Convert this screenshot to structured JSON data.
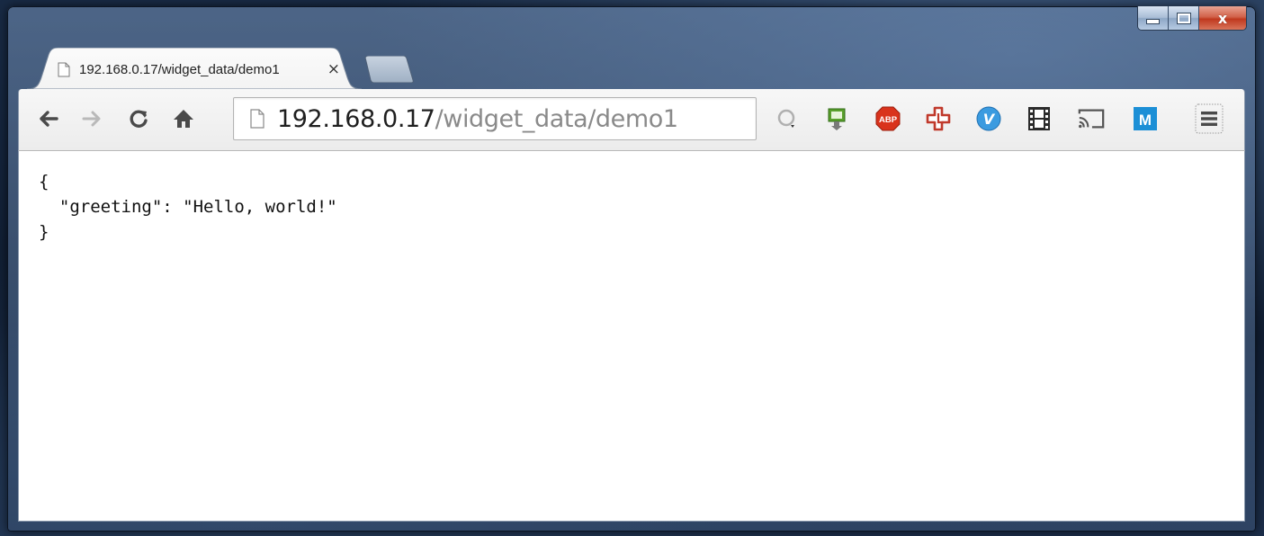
{
  "window": {
    "controls": {
      "minimize_icon": "minimize-icon",
      "maximize_icon": "maximize-icon",
      "close_glyph": "x"
    }
  },
  "tab": {
    "title": "192.168.0.17/widget_data/demo1",
    "close_glyph": "×",
    "favicon": "page-icon"
  },
  "toolbar": {
    "nav": {
      "back_icon": "back-arrow-icon",
      "forward_icon": "forward-arrow-icon",
      "reload_icon": "reload-icon",
      "home_icon": "home-icon"
    },
    "omnibox": {
      "page_icon": "page-icon",
      "url_host": "192.168.0.17",
      "url_path": "/widget_data/demo1"
    },
    "extensions": [
      "search-extension-icon",
      "green-arrow-extension-icon",
      "adblock-plus-icon",
      "red-cross-extension-icon",
      "v-extension-icon",
      "film-extension-icon",
      "cast-icon",
      "m-extension-icon",
      "menu-icon"
    ],
    "abp_label": "ABP",
    "m_label": "M",
    "v_label": "V"
  },
  "content": {
    "lines": [
      "{",
      "  \"greeting\": \"Hello, world!\"",
      "}"
    ]
  }
}
